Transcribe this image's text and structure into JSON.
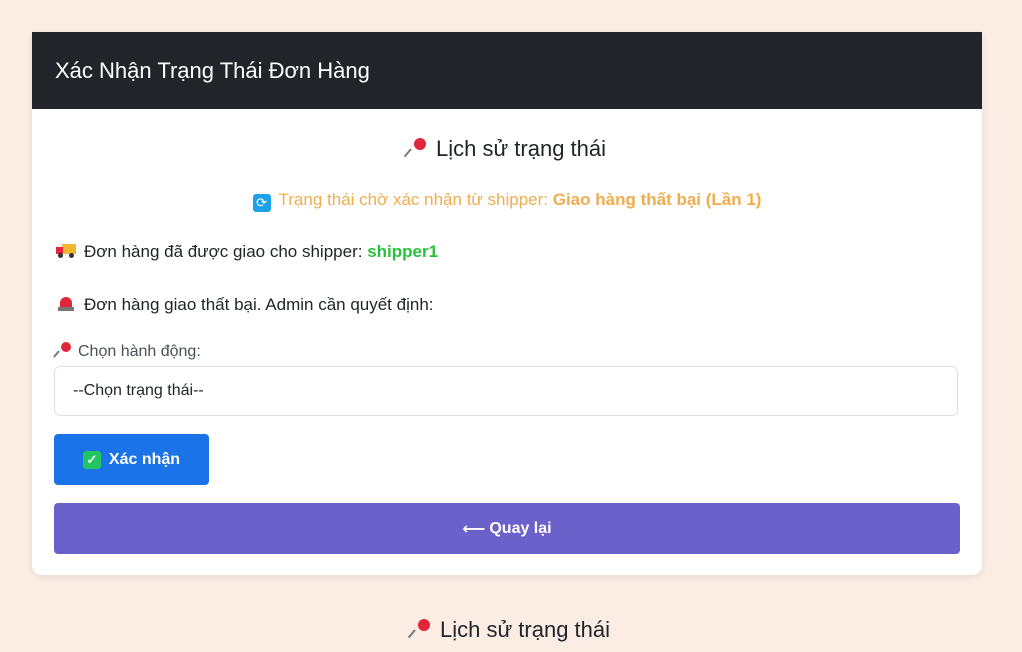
{
  "header": {
    "title": "Xác Nhận Trạng Thái Đơn Hàng"
  },
  "history": {
    "title": "Lịch sử trạng thái"
  },
  "status": {
    "prefix": "Trạng thái chờ xác nhận từ shipper: ",
    "value": "Giao hàng thất bại (Lần 1)",
    "color": "#f0ad4e",
    "icon": "refresh-icon"
  },
  "assigned": {
    "text": "Đơn hàng đã được giao cho shipper: ",
    "shipper": "shipper1",
    "icon": "truck-icon"
  },
  "failed": {
    "text": "Đơn hàng giao thất bại. Admin cần quyết định:",
    "icon": "siren-icon"
  },
  "action": {
    "label": "Chọn hành động:",
    "selected": "--Chọn trạng thái--"
  },
  "buttons": {
    "confirm": "Xác nhận",
    "back": "Quay lại",
    "confirm_color": "#1a73e8",
    "back_color": "#6a61cb"
  },
  "outer_history": {
    "title": "Lịch sử trạng thái"
  }
}
